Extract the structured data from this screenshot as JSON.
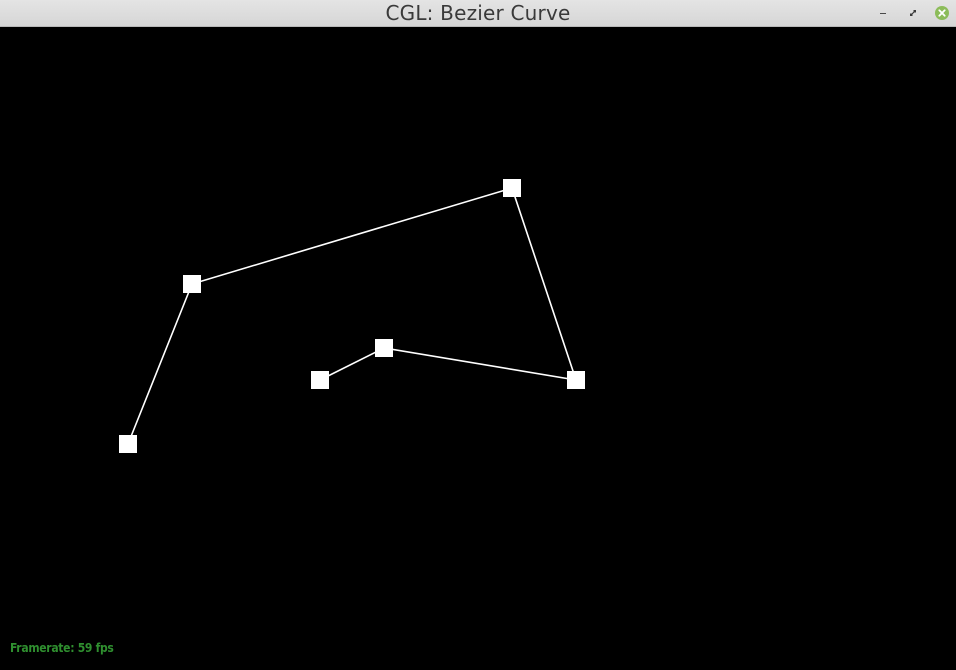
{
  "window": {
    "title": "CGL: Bezier Curve",
    "controls": {
      "minimize_icon": "minimize-icon",
      "maximize_icon": "restore-icon",
      "close_icon": "close-icon"
    }
  },
  "scene": {
    "background_color": "#000000",
    "line_color": "#ffffff",
    "control_point_color": "#ffffff",
    "control_point_count": 6
  },
  "hud": {
    "framerate_label": "Framerate:",
    "framerate_value": "59 fps",
    "color": "#2f8f2f"
  }
}
